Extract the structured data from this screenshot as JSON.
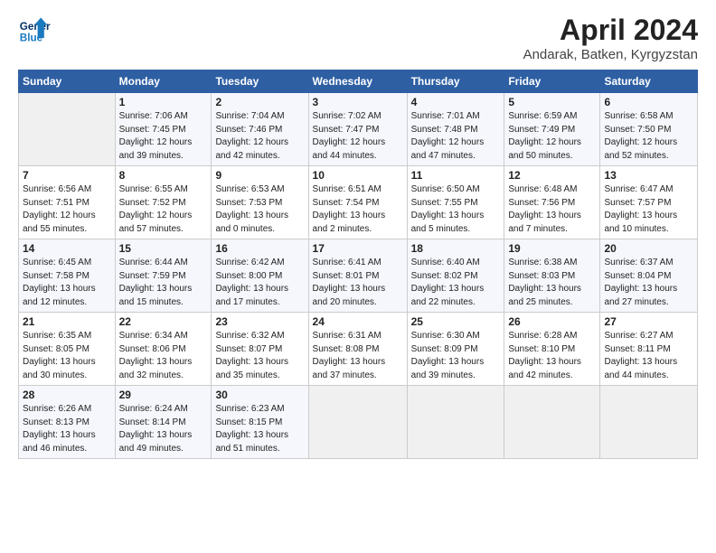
{
  "header": {
    "logo_line1": "General",
    "logo_line2": "Blue",
    "title": "April 2024",
    "location": "Andarak, Batken, Kyrgyzstan"
  },
  "columns": [
    "Sunday",
    "Monday",
    "Tuesday",
    "Wednesday",
    "Thursday",
    "Friday",
    "Saturday"
  ],
  "rows": [
    [
      {
        "empty": true
      },
      {
        "date": "1",
        "sunrise": "Sunrise: 7:06 AM",
        "sunset": "Sunset: 7:45 PM",
        "daylight": "Daylight: 12 hours and 39 minutes."
      },
      {
        "date": "2",
        "sunrise": "Sunrise: 7:04 AM",
        "sunset": "Sunset: 7:46 PM",
        "daylight": "Daylight: 12 hours and 42 minutes."
      },
      {
        "date": "3",
        "sunrise": "Sunrise: 7:02 AM",
        "sunset": "Sunset: 7:47 PM",
        "daylight": "Daylight: 12 hours and 44 minutes."
      },
      {
        "date": "4",
        "sunrise": "Sunrise: 7:01 AM",
        "sunset": "Sunset: 7:48 PM",
        "daylight": "Daylight: 12 hours and 47 minutes."
      },
      {
        "date": "5",
        "sunrise": "Sunrise: 6:59 AM",
        "sunset": "Sunset: 7:49 PM",
        "daylight": "Daylight: 12 hours and 50 minutes."
      },
      {
        "date": "6",
        "sunrise": "Sunrise: 6:58 AM",
        "sunset": "Sunset: 7:50 PM",
        "daylight": "Daylight: 12 hours and 52 minutes."
      }
    ],
    [
      {
        "date": "7",
        "sunrise": "Sunrise: 6:56 AM",
        "sunset": "Sunset: 7:51 PM",
        "daylight": "Daylight: 12 hours and 55 minutes."
      },
      {
        "date": "8",
        "sunrise": "Sunrise: 6:55 AM",
        "sunset": "Sunset: 7:52 PM",
        "daylight": "Daylight: 12 hours and 57 minutes."
      },
      {
        "date": "9",
        "sunrise": "Sunrise: 6:53 AM",
        "sunset": "Sunset: 7:53 PM",
        "daylight": "Daylight: 13 hours and 0 minutes."
      },
      {
        "date": "10",
        "sunrise": "Sunrise: 6:51 AM",
        "sunset": "Sunset: 7:54 PM",
        "daylight": "Daylight: 13 hours and 2 minutes."
      },
      {
        "date": "11",
        "sunrise": "Sunrise: 6:50 AM",
        "sunset": "Sunset: 7:55 PM",
        "daylight": "Daylight: 13 hours and 5 minutes."
      },
      {
        "date": "12",
        "sunrise": "Sunrise: 6:48 AM",
        "sunset": "Sunset: 7:56 PM",
        "daylight": "Daylight: 13 hours and 7 minutes."
      },
      {
        "date": "13",
        "sunrise": "Sunrise: 6:47 AM",
        "sunset": "Sunset: 7:57 PM",
        "daylight": "Daylight: 13 hours and 10 minutes."
      }
    ],
    [
      {
        "date": "14",
        "sunrise": "Sunrise: 6:45 AM",
        "sunset": "Sunset: 7:58 PM",
        "daylight": "Daylight: 13 hours and 12 minutes."
      },
      {
        "date": "15",
        "sunrise": "Sunrise: 6:44 AM",
        "sunset": "Sunset: 7:59 PM",
        "daylight": "Daylight: 13 hours and 15 minutes."
      },
      {
        "date": "16",
        "sunrise": "Sunrise: 6:42 AM",
        "sunset": "Sunset: 8:00 PM",
        "daylight": "Daylight: 13 hours and 17 minutes."
      },
      {
        "date": "17",
        "sunrise": "Sunrise: 6:41 AM",
        "sunset": "Sunset: 8:01 PM",
        "daylight": "Daylight: 13 hours and 20 minutes."
      },
      {
        "date": "18",
        "sunrise": "Sunrise: 6:40 AM",
        "sunset": "Sunset: 8:02 PM",
        "daylight": "Daylight: 13 hours and 22 minutes."
      },
      {
        "date": "19",
        "sunrise": "Sunrise: 6:38 AM",
        "sunset": "Sunset: 8:03 PM",
        "daylight": "Daylight: 13 hours and 25 minutes."
      },
      {
        "date": "20",
        "sunrise": "Sunrise: 6:37 AM",
        "sunset": "Sunset: 8:04 PM",
        "daylight": "Daylight: 13 hours and 27 minutes."
      }
    ],
    [
      {
        "date": "21",
        "sunrise": "Sunrise: 6:35 AM",
        "sunset": "Sunset: 8:05 PM",
        "daylight": "Daylight: 13 hours and 30 minutes."
      },
      {
        "date": "22",
        "sunrise": "Sunrise: 6:34 AM",
        "sunset": "Sunset: 8:06 PM",
        "daylight": "Daylight: 13 hours and 32 minutes."
      },
      {
        "date": "23",
        "sunrise": "Sunrise: 6:32 AM",
        "sunset": "Sunset: 8:07 PM",
        "daylight": "Daylight: 13 hours and 35 minutes."
      },
      {
        "date": "24",
        "sunrise": "Sunrise: 6:31 AM",
        "sunset": "Sunset: 8:08 PM",
        "daylight": "Daylight: 13 hours and 37 minutes."
      },
      {
        "date": "25",
        "sunrise": "Sunrise: 6:30 AM",
        "sunset": "Sunset: 8:09 PM",
        "daylight": "Daylight: 13 hours and 39 minutes."
      },
      {
        "date": "26",
        "sunrise": "Sunrise: 6:28 AM",
        "sunset": "Sunset: 8:10 PM",
        "daylight": "Daylight: 13 hours and 42 minutes."
      },
      {
        "date": "27",
        "sunrise": "Sunrise: 6:27 AM",
        "sunset": "Sunset: 8:11 PM",
        "daylight": "Daylight: 13 hours and 44 minutes."
      }
    ],
    [
      {
        "date": "28",
        "sunrise": "Sunrise: 6:26 AM",
        "sunset": "Sunset: 8:13 PM",
        "daylight": "Daylight: 13 hours and 46 minutes."
      },
      {
        "date": "29",
        "sunrise": "Sunrise: 6:24 AM",
        "sunset": "Sunset: 8:14 PM",
        "daylight": "Daylight: 13 hours and 49 minutes."
      },
      {
        "date": "30",
        "sunrise": "Sunrise: 6:23 AM",
        "sunset": "Sunset: 8:15 PM",
        "daylight": "Daylight: 13 hours and 51 minutes."
      },
      {
        "empty": true
      },
      {
        "empty": true
      },
      {
        "empty": true
      },
      {
        "empty": true
      }
    ]
  ]
}
